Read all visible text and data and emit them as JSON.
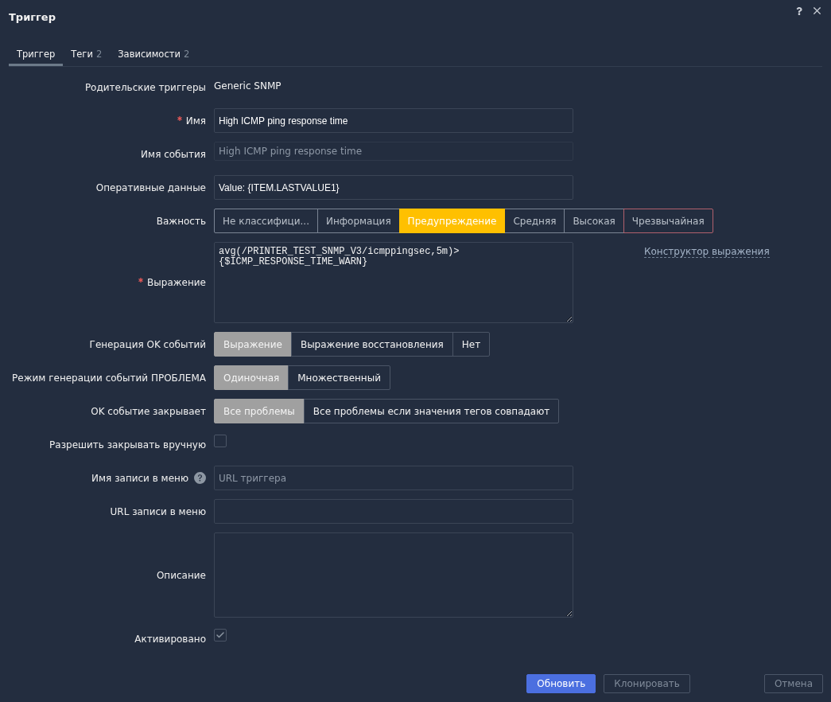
{
  "dialog": {
    "title": "Триггер"
  },
  "tabs": [
    {
      "label": "Триггер",
      "selected": true
    },
    {
      "label": "Теги",
      "count": "2",
      "selected": false
    },
    {
      "label": "Зависимости",
      "count": "2",
      "selected": false
    }
  ],
  "form": {
    "rows": [
      {
        "kind": "static",
        "label": "Родительские триггеры",
        "required": false,
        "help": false,
        "value": "Generic SNMP"
      },
      {
        "kind": "input",
        "label": "Имя",
        "required": true,
        "help": false,
        "value": "High ICMP ping response time"
      },
      {
        "kind": "slim",
        "label": "Имя события",
        "required": false,
        "help": false,
        "placeholder": "High ICMP ping response time"
      },
      {
        "kind": "input",
        "label": "Оперативные данные",
        "required": false,
        "help": false,
        "value": "Value: {ITEM.LASTVALUE1}"
      },
      {
        "kind": "severity",
        "label": "Важность",
        "required": false,
        "help": false,
        "options": [
          {
            "label": "Не классифици...",
            "selected": false,
            "hovered": false
          },
          {
            "label": "Информация",
            "selected": false,
            "hovered": false
          },
          {
            "label": "Предупреждение",
            "selected": true,
            "hovered": false
          },
          {
            "label": "Средняя",
            "selected": false,
            "hovered": false
          },
          {
            "label": "Высокая",
            "selected": false,
            "hovered": false
          },
          {
            "label": "Чрезвычайная",
            "selected": false,
            "hovered": true
          }
        ]
      },
      {
        "kind": "expression",
        "label": "Выражение",
        "required": true,
        "help": false,
        "value": "avg(/PRINTER_TEST_SNMP_V3/icmppingsec,5m)>\n{$ICMP_RESPONSE_TIME_WARN}",
        "link": "Конструктор выражения"
      },
      {
        "kind": "toggle",
        "label": "Генерация OK событий",
        "required": false,
        "help": false,
        "options": [
          {
            "label": "Выражение",
            "selected": true
          },
          {
            "label": "Выражение восстановления",
            "selected": false
          },
          {
            "label": "Нет",
            "selected": false
          }
        ]
      },
      {
        "kind": "toggle",
        "label": "Режим генерации событий ПРОБЛЕМА",
        "required": false,
        "help": false,
        "options": [
          {
            "label": "Одиночная",
            "selected": true
          },
          {
            "label": "Множественный",
            "selected": false
          }
        ]
      },
      {
        "kind": "toggle",
        "label": "OK событие закрывает",
        "required": false,
        "help": false,
        "options": [
          {
            "label": "Все проблемы",
            "selected": true
          },
          {
            "label": "Все проблемы если значения тегов совпадают",
            "selected": false
          }
        ]
      },
      {
        "kind": "checkbox",
        "label": "Разрешить закрывать вручную",
        "required": false,
        "help": false,
        "checked": false
      },
      {
        "kind": "input",
        "label": "Имя записи в меню",
        "required": false,
        "help": true,
        "placeholder": "URL триггера"
      },
      {
        "kind": "input",
        "label": "URL записи в меню",
        "required": false,
        "help": false
      },
      {
        "kind": "textarea",
        "label": "Описание",
        "required": false,
        "help": false
      },
      {
        "kind": "checkbox",
        "label": "Активировано",
        "required": false,
        "help": false,
        "checked": true
      }
    ]
  },
  "buttons": [
    {
      "label": "Обновить",
      "kind": "primary"
    },
    {
      "label": "Клонировать",
      "kind": "secondary"
    },
    {
      "label": "Отмена",
      "kind": "cancel"
    }
  ]
}
